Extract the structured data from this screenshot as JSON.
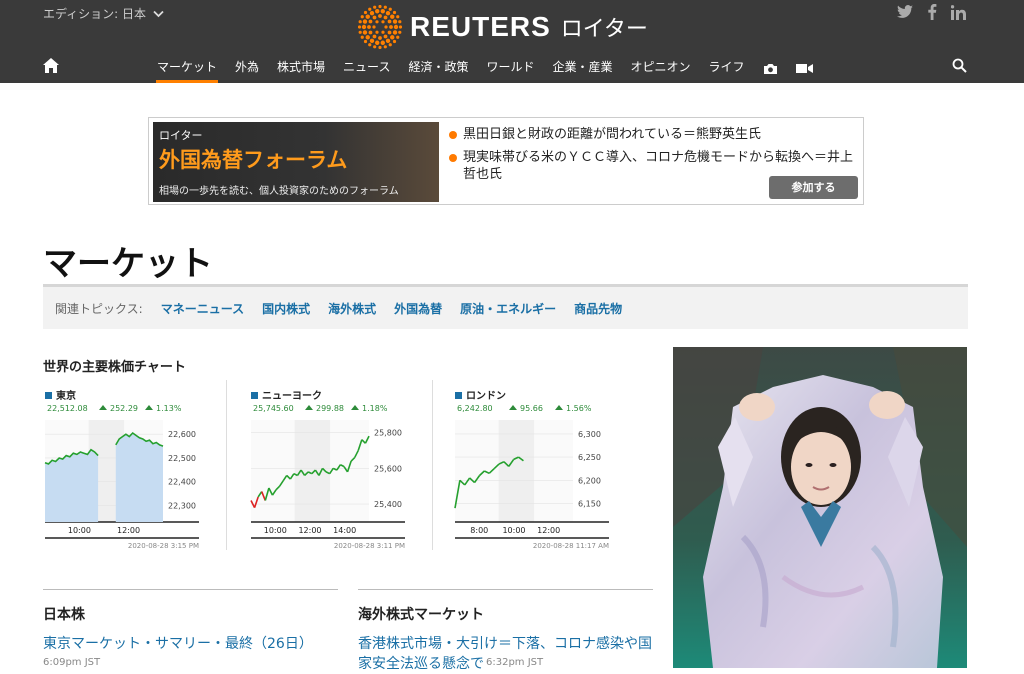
{
  "header": {
    "edition": "エディション: 日本",
    "logo_text": "REUTERS",
    "logo_jp": "ロイター",
    "social": [
      "twitter-icon",
      "facebook-icon",
      "linkedin-icon"
    ]
  },
  "nav": {
    "items": [
      "マーケット",
      "外為",
      "株式市場",
      "ニュース",
      "経済・政策",
      "ワールド",
      "企業・産業",
      "オピニオン",
      "ライフ"
    ],
    "active_index": 0
  },
  "ad": {
    "brand": "ロイター",
    "title": "外国為替フォーラム",
    "tagline": "相場の一歩先を読む、個人投資家のためのフォーラム",
    "items": [
      "黒田日銀と財政の距離が問われている＝熊野英生氏",
      "現実味帯びる米のＹＣＣ導入、コロナ危機モードから転換へ＝井上哲也氏"
    ],
    "button": "参加する"
  },
  "page": {
    "title": "マーケット",
    "topics_label": "関連トピックス:",
    "topics": [
      "マネーニュース",
      "国内株式",
      "海外株式",
      "外国為替",
      "原油・エネルギー",
      "商品先物"
    ]
  },
  "charts_section": {
    "title": "世界の主要株価チャート"
  },
  "chart_data": [
    {
      "type": "line",
      "title": "東京",
      "last": "22,512.08",
      "change": "252.29",
      "pct": "1.13%",
      "x_ticks": [
        "10:00",
        "12:00"
      ],
      "y_ticks": [
        "22,600",
        "22,500",
        "22,400",
        "22,300"
      ],
      "ylim": [
        22230,
        22660
      ],
      "timestamp": "2020-08-28 3:15 PM",
      "series": [
        {
          "values": [
            22480,
            22475,
            22490,
            22485,
            22500,
            22495,
            22510,
            22505,
            22520,
            22515,
            22525,
            22520,
            22515,
            22535,
            22525,
            22510
          ]
        },
        {
          "values": [
            22555,
            22580,
            22590,
            22600,
            22590,
            22605,
            22595,
            22585,
            22580,
            22570,
            22575,
            22560,
            22565,
            22555,
            22550
          ]
        }
      ]
    },
    {
      "type": "line",
      "title": "ニューヨーク",
      "last": "25,745.60",
      "change": "299.88",
      "pct": "1.18%",
      "x_ticks": [
        "10:00",
        "12:00",
        "14:00"
      ],
      "y_ticks": [
        "25,800",
        "25,600",
        "25,400"
      ],
      "ylim": [
        25300,
        25870
      ],
      "timestamp": "2020-08-28 3:11 PM",
      "series": [
        {
          "values": [
            25420,
            25380,
            25440,
            25470,
            25420,
            25490,
            25450,
            25480,
            25500,
            25530,
            25560,
            25540,
            25570,
            25560,
            25590,
            25560,
            25580,
            25570,
            25590,
            25560,
            25600,
            25580,
            25570,
            25600,
            25590,
            25620,
            25610,
            25580,
            25640,
            25660,
            25700,
            25760,
            25740,
            25780
          ]
        }
      ]
    },
    {
      "type": "line",
      "title": "ロンドン",
      "last": "6,242.80",
      "change": "95.66",
      "pct": "1.56%",
      "x_ticks": [
        "8:00",
        "10:00",
        "12:00"
      ],
      "y_ticks": [
        "6,300",
        "6,250",
        "6,200",
        "6,150"
      ],
      "ylim": [
        6110,
        6330
      ],
      "timestamp": "2020-08-28 11:17 AM",
      "series": [
        {
          "values": [
            6140,
            6200,
            6190,
            6205,
            6195,
            6210,
            6220,
            6215,
            6225,
            6235,
            6240,
            6230,
            6245,
            6250,
            6242
          ]
        }
      ]
    }
  ],
  "sections": [
    {
      "title": "日本株",
      "headline": "東京マーケット・サマリー・最終（26日）",
      "time": "6:09pm JST"
    },
    {
      "title": "海外株式マーケット",
      "headline": "香港株式市場・大引け＝下落、コロナ感染や国家安全法巡る懸念で",
      "time": "6:32pm JST"
    }
  ]
}
